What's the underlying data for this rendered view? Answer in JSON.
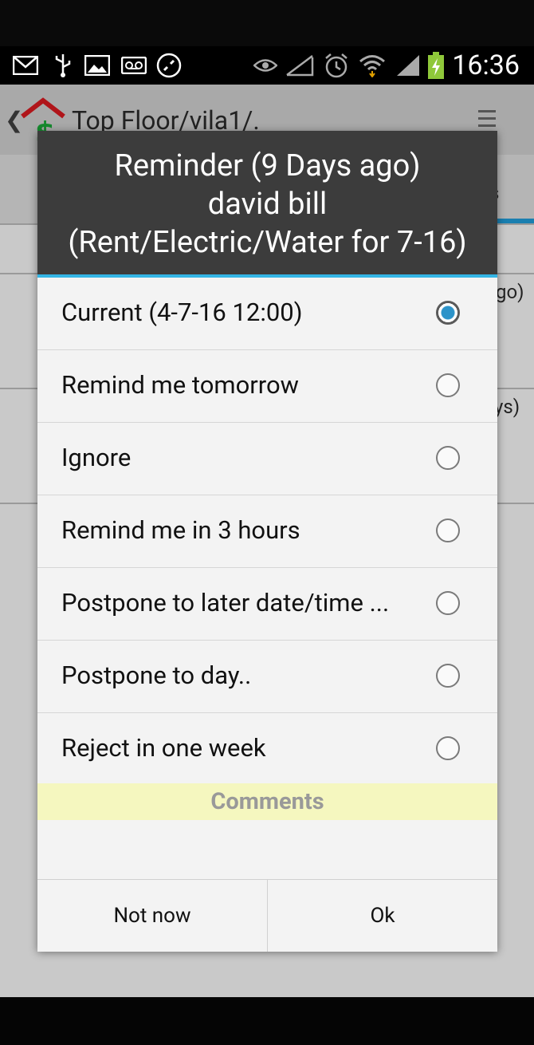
{
  "status_bar": {
    "time": "16:36",
    "icons": [
      "mail-icon",
      "usb-icon",
      "image-icon",
      "voicemail-icon",
      "call-icon",
      "eye-icon",
      "no-signal-icon",
      "alarm-icon",
      "wifi-icon",
      "signal-icon",
      "battery-icon"
    ]
  },
  "app": {
    "title": "Top Floor/vila1/.",
    "bg_fragments": [
      "go)",
      "ys)",
      "s"
    ]
  },
  "dialog": {
    "title_line1": "Reminder (9 Days ago)",
    "title_line2": "david bill",
    "title_line3": "(Rent/Electric/Water for 7-16)",
    "accent_color": "#33b5e5",
    "options": [
      {
        "label": "Current (4-7-16 12:00)",
        "selected": true
      },
      {
        "label": "Remind me tomorrow",
        "selected": false
      },
      {
        "label": "Ignore",
        "selected": false
      },
      {
        "label": "Remind me in 3 hours",
        "selected": false
      },
      {
        "label": "Postpone to later date/time ...",
        "selected": false
      },
      {
        "label": "Postpone to day..",
        "selected": false
      },
      {
        "label": "Reject in one week",
        "selected": false
      }
    ],
    "comments_label": "Comments",
    "comments_value": "",
    "buttons": {
      "not_now": "Not now",
      "ok": "Ok"
    }
  }
}
